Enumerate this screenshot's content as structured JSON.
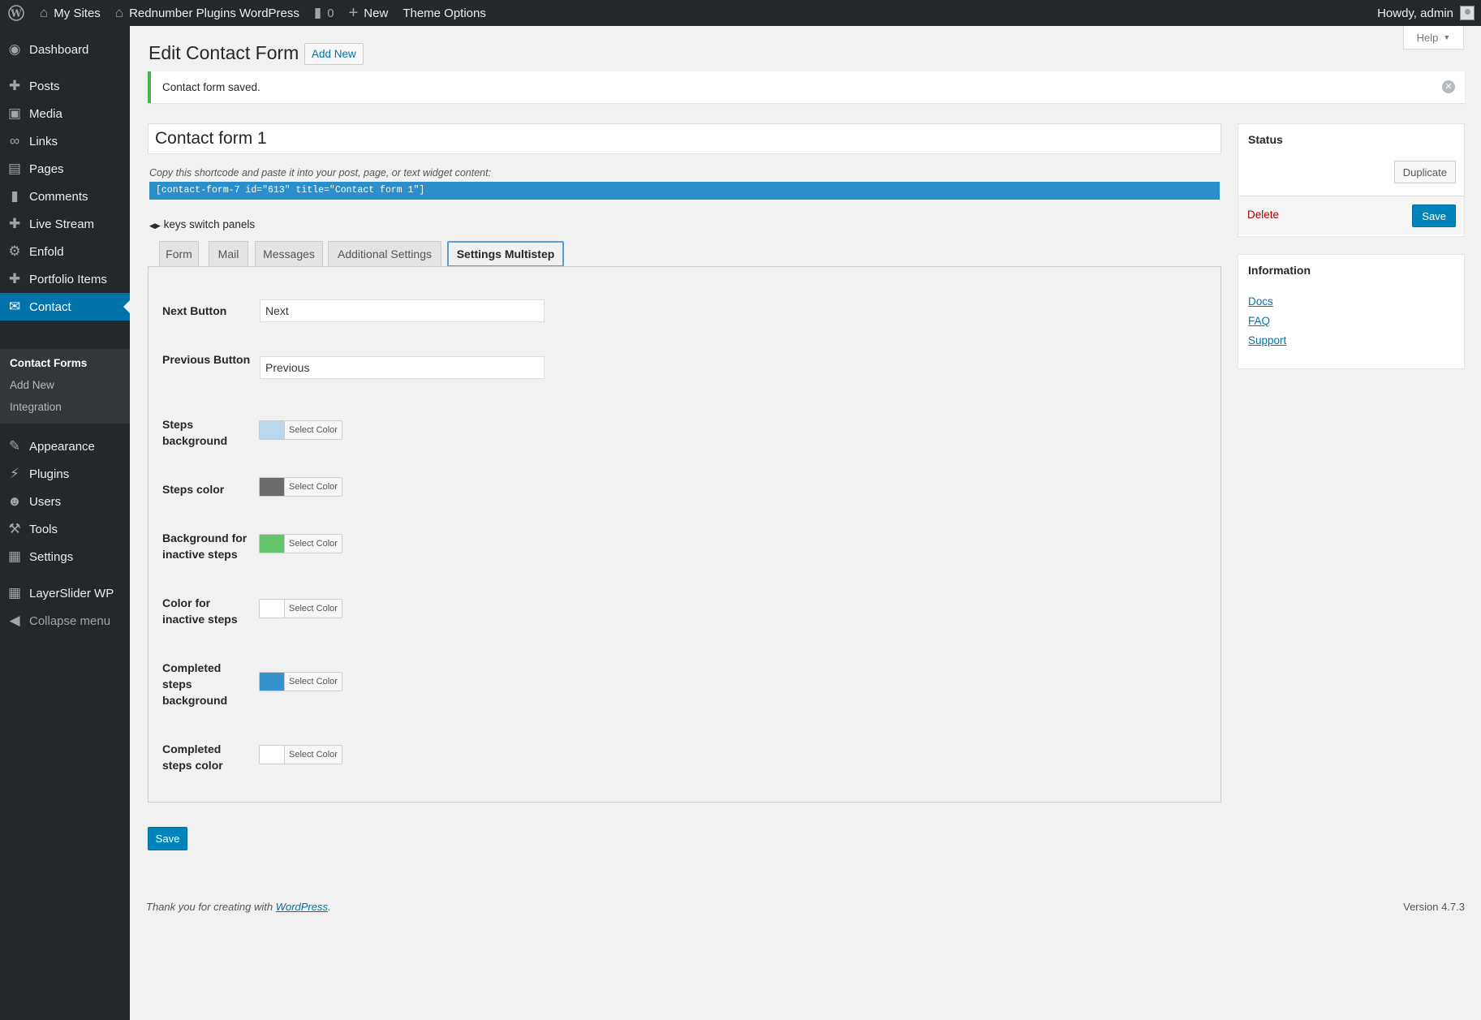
{
  "adminbar": {
    "my_sites": "My Sites",
    "site_name": "Rednumber Plugins WordPress",
    "comments_count": "0",
    "new_label": "New",
    "theme_options": "Theme Options",
    "howdy": "Howdy, admin"
  },
  "menu": {
    "items": [
      {
        "label": "Dashboard",
        "icon": "dashboard-icon"
      },
      {
        "label": "Posts",
        "icon": "pin-icon"
      },
      {
        "label": "Media",
        "icon": "media-icon"
      },
      {
        "label": "Links",
        "icon": "link-icon"
      },
      {
        "label": "Pages",
        "icon": "pages-icon"
      },
      {
        "label": "Comments",
        "icon": "comment-icon"
      },
      {
        "label": "Live Stream",
        "icon": "pin-icon"
      },
      {
        "label": "Enfold",
        "icon": "gear-icon"
      },
      {
        "label": "Portfolio Items",
        "icon": "pin-icon"
      },
      {
        "label": "Contact",
        "icon": "mail-icon"
      },
      {
        "label": "Appearance",
        "icon": "brush-icon"
      },
      {
        "label": "Plugins",
        "icon": "plugin-icon"
      },
      {
        "label": "Users",
        "icon": "user-icon"
      },
      {
        "label": "Tools",
        "icon": "wrench-icon"
      },
      {
        "label": "Settings",
        "icon": "settings-icon"
      },
      {
        "label": "LayerSlider WP",
        "icon": "layers-icon"
      },
      {
        "label": "Collapse menu",
        "icon": "collapse-icon"
      }
    ],
    "submenu": [
      "Contact Forms",
      "Add New",
      "Integration"
    ]
  },
  "page": {
    "title": "Edit Contact Form",
    "add_new": "Add New",
    "help": "Help",
    "notice": "Contact form saved.",
    "form_title": "Contact form 1",
    "shortcode_hint": "Copy this shortcode and paste it into your post, page, or text widget content:",
    "shortcode": "[contact-form-7 id=\"613\" title=\"Contact form 1\"]",
    "keys_hint": "keys switch panels"
  },
  "tabs": [
    "Form",
    "Mail",
    "Messages",
    "Additional Settings",
    "Settings Multistep"
  ],
  "settings": {
    "next_label": "Next Button",
    "next_value": "Next",
    "prev_label": "Previous Button",
    "prev_value": "Previous",
    "select_color": "Select Color",
    "colors": [
      {
        "label": "Steps background",
        "color": "#b8d8ee"
      },
      {
        "label": "Steps color",
        "color": "#6b6b6b"
      },
      {
        "label": "Background for inactive steps",
        "color": "#63c46c"
      },
      {
        "label": "Color for inactive steps",
        "color": "#ffffff"
      },
      {
        "label": "Completed steps background",
        "color": "#3591cc"
      },
      {
        "label": "Completed steps color",
        "color": "#ffffff"
      }
    ]
  },
  "save_label": "Save",
  "status_box": {
    "title": "Status",
    "duplicate": "Duplicate",
    "delete": "Delete",
    "save": "Save"
  },
  "info_box": {
    "title": "Information",
    "links": [
      "Docs",
      "FAQ",
      "Support"
    ]
  },
  "footer": {
    "thanks_prefix": "Thank you for creating with ",
    "wordpress": "WordPress",
    "thanks_suffix": ".",
    "version": "Version 4.7.3"
  }
}
